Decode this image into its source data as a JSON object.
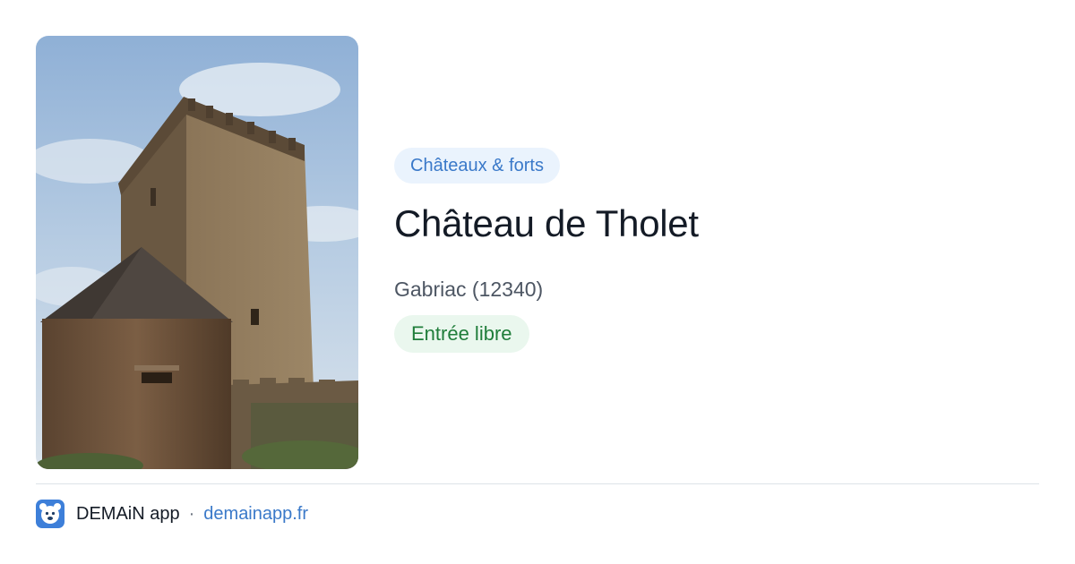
{
  "card": {
    "category": "Châteaux & forts",
    "title": "Château de Tholet",
    "location": "Gabriac (12340)",
    "badge": "Entrée libre",
    "image_icon": "castle-photo"
  },
  "footer": {
    "app_name": "DEMAiN app",
    "separator": "·",
    "link": "demainapp.fr",
    "icon": "demain-app-icon"
  },
  "colors": {
    "category_bg": "#eaf3fd",
    "category_text": "#3a79c9",
    "badge_bg": "#eaf7ee",
    "badge_text": "#1f7d3a",
    "title_text": "#141b26",
    "link_text": "#3a79c9"
  }
}
